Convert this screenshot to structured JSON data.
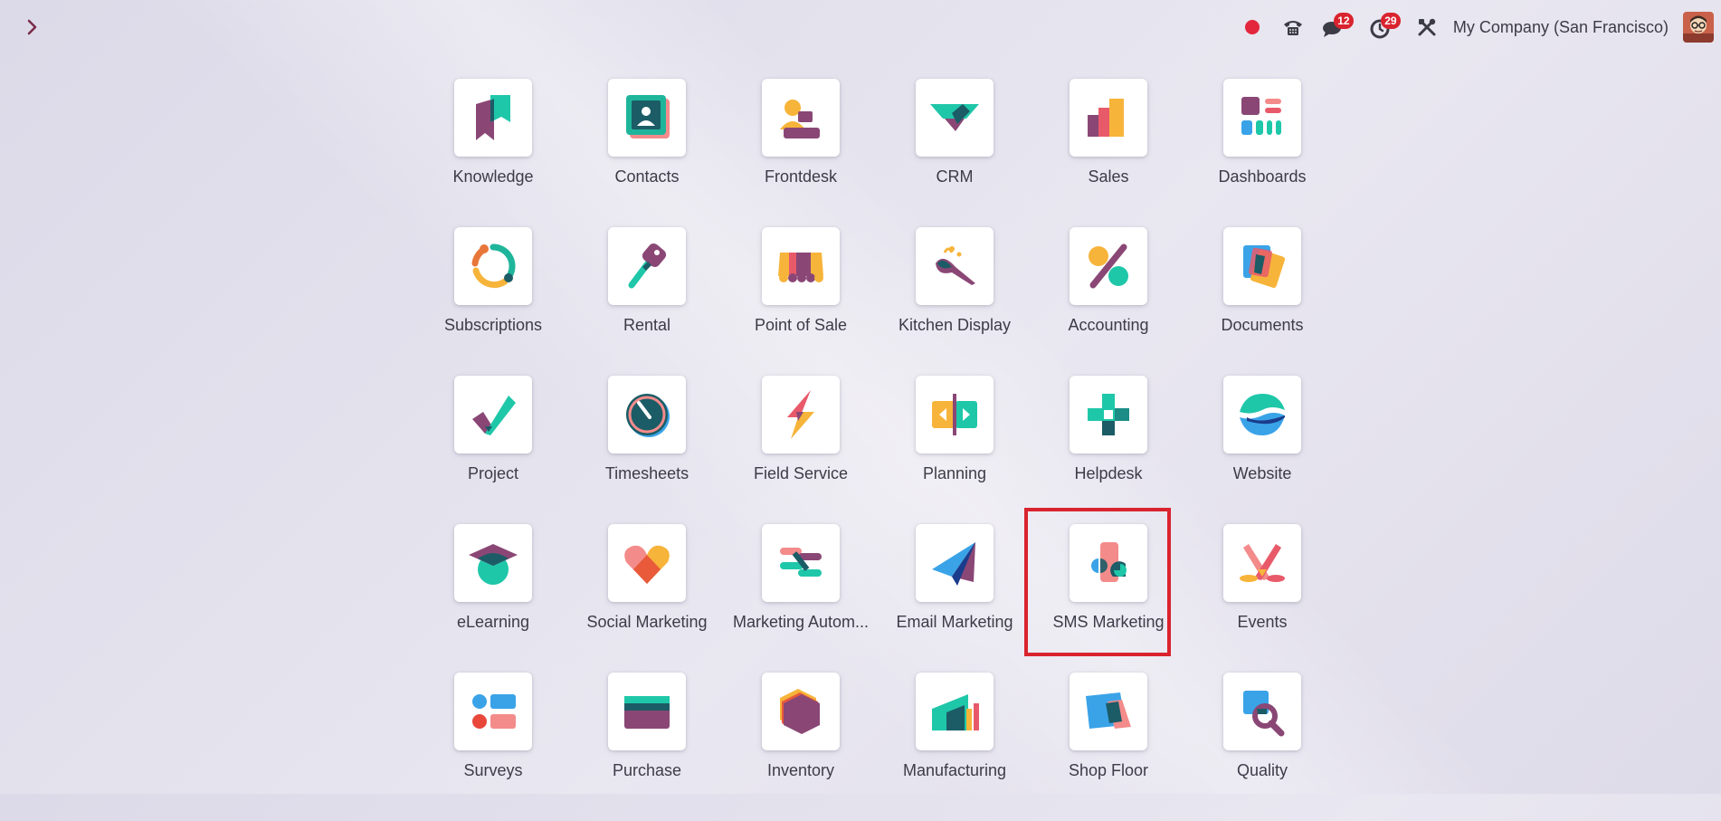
{
  "systray": {
    "company": "My Company (San Francisco)",
    "messages_count": "12",
    "activities_count": "29"
  },
  "colors": {
    "highlight": "#d9232e",
    "badge": "#d9232e"
  },
  "apps": [
    {
      "label": "Knowledge",
      "icon": "knowledge-icon"
    },
    {
      "label": "Contacts",
      "icon": "contacts-icon"
    },
    {
      "label": "Frontdesk",
      "icon": "frontdesk-icon"
    },
    {
      "label": "CRM",
      "icon": "crm-icon"
    },
    {
      "label": "Sales",
      "icon": "sales-icon"
    },
    {
      "label": "Dashboards",
      "icon": "dashboards-icon"
    },
    {
      "label": "Subscriptions",
      "icon": "subscriptions-icon"
    },
    {
      "label": "Rental",
      "icon": "rental-icon"
    },
    {
      "label": "Point of Sale",
      "icon": "point-of-sale-icon"
    },
    {
      "label": "Kitchen Display",
      "icon": "kitchen-display-icon"
    },
    {
      "label": "Accounting",
      "icon": "accounting-icon"
    },
    {
      "label": "Documents",
      "icon": "documents-icon"
    },
    {
      "label": "Project",
      "icon": "project-icon"
    },
    {
      "label": "Timesheets",
      "icon": "timesheets-icon"
    },
    {
      "label": "Field Service",
      "icon": "field-service-icon"
    },
    {
      "label": "Planning",
      "icon": "planning-icon"
    },
    {
      "label": "Helpdesk",
      "icon": "helpdesk-icon"
    },
    {
      "label": "Website",
      "icon": "website-icon"
    },
    {
      "label": "eLearning",
      "icon": "elearning-icon"
    },
    {
      "label": "Social Marketing",
      "icon": "social-marketing-icon"
    },
    {
      "label": "Marketing Autom...",
      "icon": "marketing-automation-icon"
    },
    {
      "label": "Email Marketing",
      "icon": "email-marketing-icon"
    },
    {
      "label": "SMS Marketing",
      "icon": "sms-marketing-icon",
      "highlighted": true
    },
    {
      "label": "Events",
      "icon": "events-icon"
    },
    {
      "label": "Surveys",
      "icon": "surveys-icon"
    },
    {
      "label": "Purchase",
      "icon": "purchase-icon"
    },
    {
      "label": "Inventory",
      "icon": "inventory-icon"
    },
    {
      "label": "Manufacturing",
      "icon": "manufacturing-icon"
    },
    {
      "label": "Shop Floor",
      "icon": "shop-floor-icon"
    },
    {
      "label": "Quality",
      "icon": "quality-icon"
    }
  ]
}
